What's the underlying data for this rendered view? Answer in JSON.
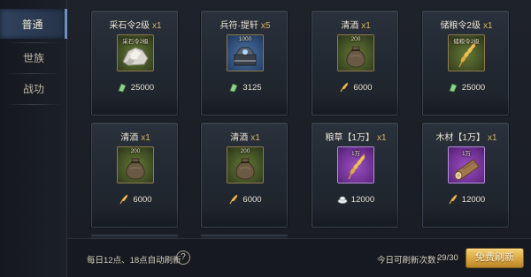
{
  "sidebar": {
    "tabs": [
      {
        "label": "普通",
        "active": true
      },
      {
        "label": "世族",
        "active": false
      },
      {
        "label": "战功",
        "active": false
      }
    ]
  },
  "shop": {
    "items": [
      {
        "name": "采石令2级",
        "qty": "x1",
        "tag": "采石令2级",
        "icon": "stone-icon",
        "frame": "green",
        "currency": "jade-icon",
        "price": "25000"
      },
      {
        "name": "兵符·提轩",
        "qty": "x5",
        "tag": "1000",
        "icon": "tiger-tally-icon",
        "frame": "blue",
        "currency": "jade-icon",
        "price": "3125"
      },
      {
        "name": "清酒",
        "qty": "x1",
        "tag": "200",
        "icon": "wine-pouch-icon",
        "frame": "green",
        "currency": "grain-icon",
        "price": "6000"
      },
      {
        "name": "储粮令2级",
        "qty": "x1",
        "tag": "储粮令2级",
        "icon": "wheat-icon",
        "frame": "green",
        "currency": "jade-icon",
        "price": "25000"
      },
      {
        "name": "清酒",
        "qty": "x1",
        "tag": "200",
        "icon": "wine-pouch-icon",
        "frame": "green",
        "currency": "grain-icon",
        "price": "6000"
      },
      {
        "name": "清酒",
        "qty": "x1",
        "tag": "200",
        "icon": "wine-pouch-icon",
        "frame": "green",
        "currency": "grain-icon",
        "price": "6000"
      },
      {
        "name": "粮草【1万】",
        "qty": "x1",
        "tag": "1万",
        "icon": "wheat-icon",
        "frame": "purple",
        "currency": "silver-icon",
        "price": "12000"
      },
      {
        "name": "木材【1万】",
        "qty": "x1",
        "tag": "1万",
        "icon": "log-icon",
        "frame": "purple",
        "currency": "grain-icon",
        "price": "12000"
      }
    ]
  },
  "footer": {
    "auto_refresh_text": "每日12点、18点自动刷新",
    "help_symbol": "?",
    "refresh_count_label": "今日可刷新次数：",
    "refresh_count": "29/30",
    "refresh_button_label": "免费刷新"
  },
  "colors": {
    "accent_gold": "#dca741",
    "tab_active": "#30435e",
    "qty_gold": "#d6b25c"
  }
}
